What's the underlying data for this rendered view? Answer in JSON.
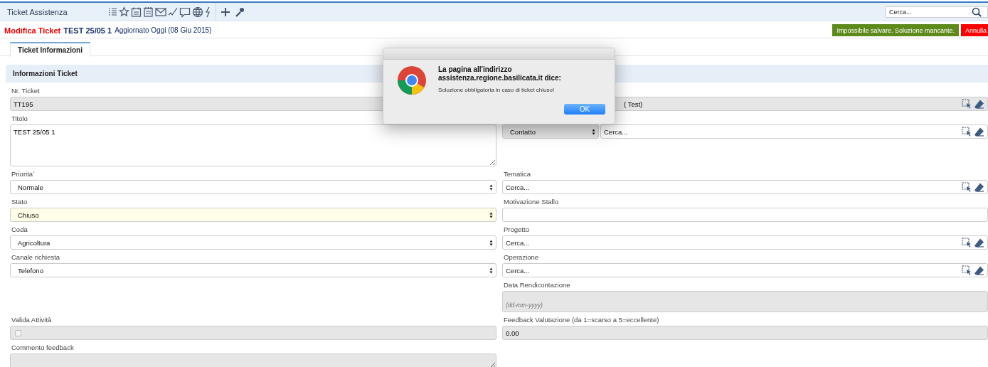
{
  "app": {
    "title": "Ticket Assistenza",
    "search": {
      "placeholder": "Cerca..."
    }
  },
  "header": {
    "action": "Modifica Ticket",
    "ticket": "TEST 25/05 1",
    "updated": "Aggiornato Oggi (08 Giu 2015)",
    "buttons": [
      {
        "label": "Impossibile salvare. Soluzione mancante.",
        "kind": "warning"
      },
      {
        "label": "Annulla",
        "kind": "cancel"
      }
    ]
  },
  "tabs": [
    {
      "label": "Ticket Informazioni",
      "selected": true
    }
  ],
  "section": {
    "title": "Informazioni Ticket"
  },
  "rows": [
    {
      "left": {
        "kind": "text",
        "label": "Nr. Ticket",
        "value": "TT195",
        "disabled": true
      },
      "right": {
        "kind": "lookup",
        "value": "( Test)",
        "disabled": true
      }
    },
    {
      "left": {
        "kind": "textarea",
        "label": "Titolo",
        "value": "TEST 25/05 1",
        "disabled": false
      },
      "right": {
        "kind": "combo",
        "select": "Contatto",
        "placeholder": "Cerca..."
      }
    },
    {
      "left": {
        "kind": "select",
        "label": "Priorita`",
        "value": "Normale",
        "highlighted": false
      },
      "right": {
        "kind": "lookup",
        "label": "Tematica",
        "placeholder": "Cerca...",
        "disabled": false
      }
    },
    {
      "left": {
        "kind": "select",
        "label": "Stato",
        "value": "Chiuso",
        "highlighted": true
      },
      "right": {
        "kind": "text",
        "label": "Motivazione Stallo",
        "disabled": false
      }
    },
    {
      "left": {
        "kind": "select",
        "label": "Coda",
        "value": "Agricoltura",
        "highlighted": false
      },
      "right": {
        "kind": "lookup",
        "label": "Progetto",
        "placeholder": "Cerca...",
        "disabled": false
      }
    },
    {
      "left": {
        "kind": "select",
        "label": "Canale richiesta",
        "value": "Telefono",
        "highlighted": false
      },
      "right": {
        "kind": "lookup",
        "label": "Operazione",
        "placeholder": "Cerca...",
        "disabled": false
      }
    },
    {
      "right": {
        "kind": "date",
        "label": "Data Rendicontazione",
        "placeholder": "(dd-mm-yyyy)"
      }
    },
    {
      "left": {
        "kind": "checkbox",
        "label": "Valida Attività",
        "checked": false
      },
      "right": {
        "kind": "text",
        "label": "Feedback Valutazione (da 1=scarso a 5=eccellente)",
        "value": "0.00",
        "disabled": true
      }
    },
    {
      "left": {
        "kind": "textarea",
        "label": "Commento feedback",
        "disabled": true
      }
    }
  ],
  "dialog": {
    "heading": "La pagina all'indirizzo assistenza.regione.basilicata.it dice:",
    "message": "Soluzione obbligatoria in caso di ticket chiuso!",
    "button": "OK"
  }
}
